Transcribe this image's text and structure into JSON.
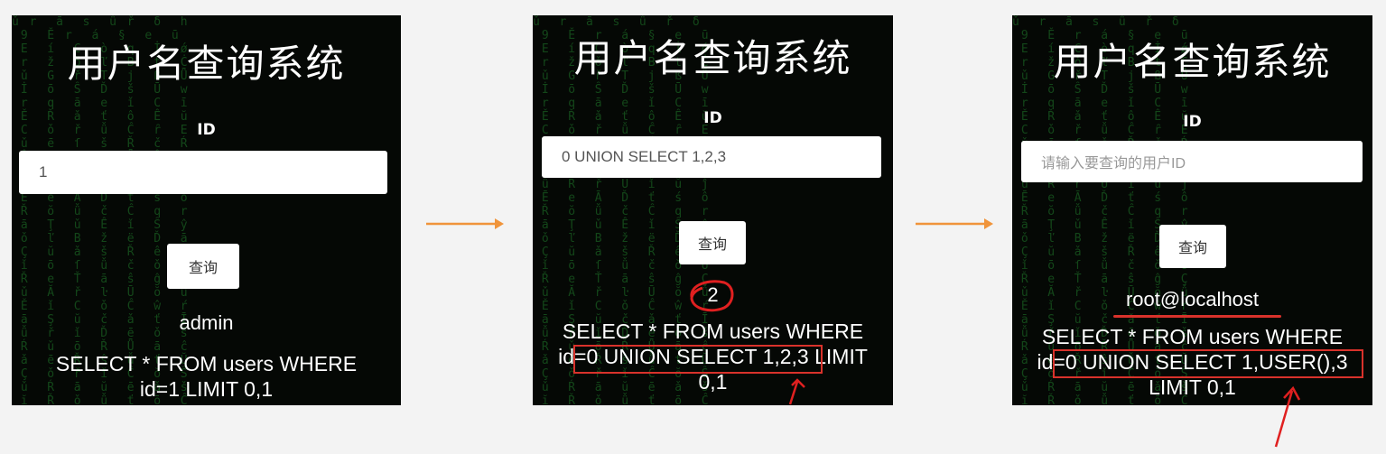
{
  "panels": [
    {
      "title": "用户名查询系统",
      "id_label": "ID",
      "input_value": "1",
      "button_label": "查询",
      "result": "admin",
      "sql_line1": "SELECT * FROM users WHERE",
      "sql_line2": "id=1 LIMIT 0,1"
    },
    {
      "title": "用户名查询系统",
      "id_label": "ID",
      "input_value": "0 UNION SELECT 1,2,3",
      "button_label": "查询",
      "result": "2",
      "sql_line1": "SELECT * FROM users WHERE",
      "sql_line2_pre": "id=",
      "sql_line2_boxed": "0 UNION SELECT 1,2,3",
      "sql_line2_post": " LIMIT",
      "sql_line3": "0,1"
    },
    {
      "title": "用户名查询系统",
      "id_label": "ID",
      "input_placeholder": "请输入要查询的用户ID",
      "button_label": "查询",
      "result": "root@localhost",
      "sql_line1": "SELECT * FROM users WHERE",
      "sql_line2_pre": "id=",
      "sql_line2_boxed": "0 UNION SELECT 1,USER(),3",
      "sql_line3": "LIMIT 0,1"
    }
  ],
  "colors": {
    "annotation_red": "#d9322b",
    "flow_arrow": "#f0943a",
    "panel_bg": "#050805",
    "matrix_green": "#1f7a2a"
  }
}
